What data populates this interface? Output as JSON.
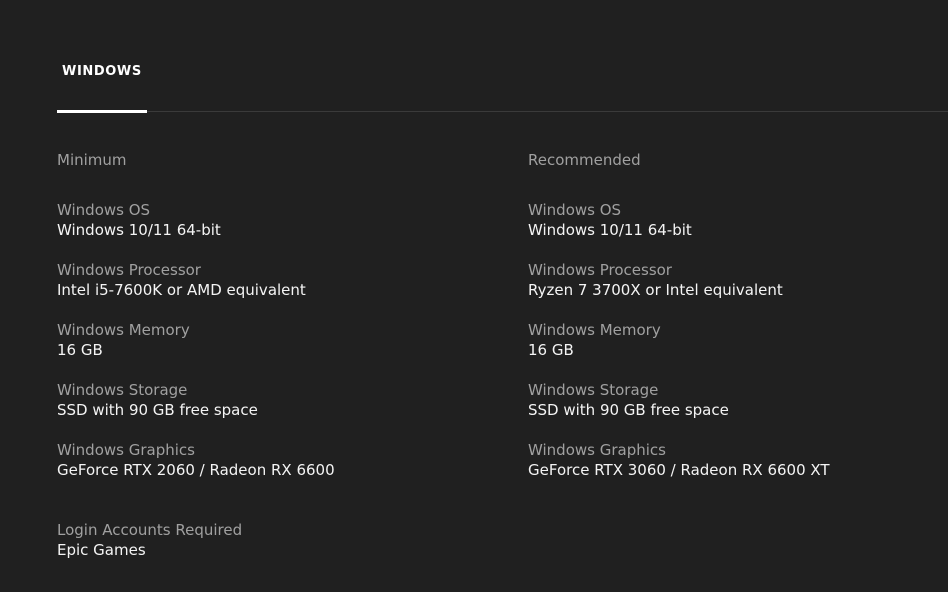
{
  "tabs": [
    {
      "label": "WINDOWS",
      "active": true
    }
  ],
  "requirements": {
    "minimum": {
      "heading": "Minimum",
      "specs": [
        {
          "label": "Windows OS",
          "value": "Windows 10/11 64-bit"
        },
        {
          "label": "Windows Processor",
          "value": "Intel i5-7600K or AMD equivalent"
        },
        {
          "label": "Windows Memory",
          "value": "16 GB"
        },
        {
          "label": "Windows Storage",
          "value": "SSD with 90 GB free space"
        },
        {
          "label": "Windows Graphics",
          "value": "GeForce RTX 2060 / Radeon RX 6600"
        }
      ]
    },
    "recommended": {
      "heading": "Recommended",
      "specs": [
        {
          "label": "Windows OS",
          "value": "Windows 10/11 64-bit"
        },
        {
          "label": "Windows Processor",
          "value": "Ryzen 7 3700X or Intel equivalent"
        },
        {
          "label": "Windows Memory",
          "value": "16 GB"
        },
        {
          "label": "Windows Storage",
          "value": "SSD with 90 GB free space"
        },
        {
          "label": "Windows Graphics",
          "value": "GeForce RTX 3060 / Radeon RX 6600 XT"
        }
      ]
    }
  },
  "login": {
    "label": "Login Accounts Required",
    "value": "Epic Games"
  },
  "colors": {
    "background": "#202020",
    "label_gray": "#a0a0a0",
    "value_white": "#f4f4f4",
    "divider": "#3a3a3a",
    "active_tab": "#ffffff"
  }
}
